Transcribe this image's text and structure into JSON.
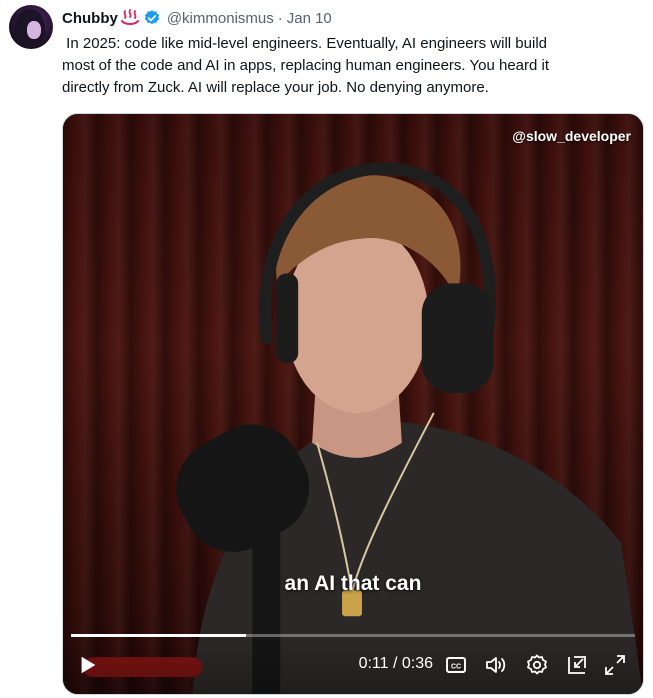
{
  "tweet": {
    "author_name": "Chubby",
    "author_emoji": "hot-springs-icon",
    "verified_icon": "verified-badge-icon",
    "handle": "@kimmonismus",
    "separator": "·",
    "date": "Jan 10",
    "text": " In 2025: code like mid-level engineers. Eventually, AI engineers will build\nmost of the code and AI in apps, replacing human engineers. You heard it\ndirectly from Zuck. AI will replace your job. No denying anymore."
  },
  "video": {
    "watermark": "@slow_developer",
    "caption": "an AI that can",
    "current_time": "0:11",
    "duration": "0:36",
    "time_display": "0:11 / 0:36",
    "progress_fraction": 0.31,
    "controls": [
      "play-icon",
      "closed-captions-icon",
      "volume-icon",
      "settings-icon",
      "pop-out-icon",
      "fullscreen-icon"
    ]
  },
  "colors": {
    "text": "#0f1419",
    "muted": "#536471",
    "verified_blue": "#1d9bf0",
    "emoji_red": "#e0245e"
  }
}
